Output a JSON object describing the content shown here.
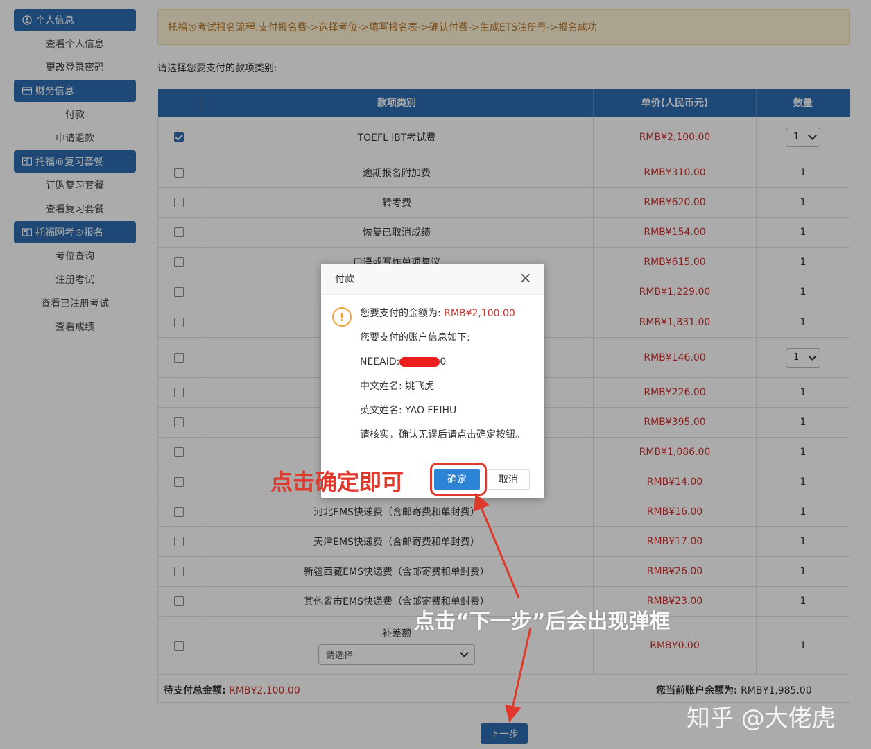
{
  "sidebar": {
    "sections": [
      {
        "title": "个人信息",
        "icon": "user-circle-icon",
        "items": [
          "查看个人信息",
          "更改登录密码"
        ]
      },
      {
        "title": "财务信息",
        "icon": "credit-card-icon",
        "items": [
          "付款",
          "申请退款"
        ]
      },
      {
        "title": "托福®复习套餐",
        "icon": "book-icon",
        "items": [
          "订购复习套餐",
          "查看复习套餐"
        ]
      },
      {
        "title": "托福网考®报名",
        "icon": "book-icon",
        "items": [
          "考位查询",
          "注册考试",
          "查看已注册考试",
          "查看成绩"
        ]
      }
    ]
  },
  "notice": "托福®考试报名流程:支付报名费->选择考位->填写报名表->确认付费->生成ETS注册号->报名成功",
  "prompt": "请选择您要支付的款项类别:",
  "table": {
    "headers": [
      "",
      "款项类别",
      "单价(人民币元)",
      "数量"
    ],
    "rows": [
      {
        "checked": true,
        "name": "TOEFL iBT考试费",
        "price": "RMB¥2,100.00",
        "qty": "1",
        "qty_select": true
      },
      {
        "checked": false,
        "name": "逾期报名附加费",
        "price": "RMB¥310.00",
        "qty": "1",
        "qty_select": false
      },
      {
        "checked": false,
        "name": "转考费",
        "price": "RMB¥620.00",
        "qty": "1",
        "qty_select": false
      },
      {
        "checked": false,
        "name": "恢复已取消成绩",
        "price": "RMB¥154.00",
        "qty": "1",
        "qty_select": false
      },
      {
        "checked": false,
        "name": "口语或写作单项复议",
        "price": "RMB¥615.00",
        "qty": "1",
        "qty_select": false
      },
      {
        "checked": false,
        "name": "",
        "price": "RMB¥1,229.00",
        "qty": "1",
        "qty_select": false
      },
      {
        "checked": false,
        "name": "",
        "price": "RMB¥1,831.00",
        "qty": "1",
        "qty_select": false
      },
      {
        "checked": false,
        "name": "",
        "price": "RMB¥146.00",
        "qty": "1",
        "qty_select": true
      },
      {
        "checked": false,
        "name": "",
        "price": "RMB¥226.00",
        "qty": "1",
        "qty_select": false
      },
      {
        "checked": false,
        "name": "",
        "price": "RMB¥395.00",
        "qty": "1",
        "qty_select": false
      },
      {
        "checked": false,
        "name": "",
        "price": "RMB¥1,086.00",
        "qty": "1",
        "qty_select": false
      },
      {
        "checked": false,
        "name": "",
        "price": "RMB¥14.00",
        "qty": "1",
        "qty_select": false
      },
      {
        "checked": false,
        "name": "河北EMS快递费（含邮寄费和单封费）",
        "price": "RMB¥16.00",
        "qty": "1",
        "qty_select": false
      },
      {
        "checked": false,
        "name": "天津EMS快递费（含邮寄费和单封费）",
        "price": "RMB¥17.00",
        "qty": "1",
        "qty_select": false
      },
      {
        "checked": false,
        "name": "新疆西藏EMS快递费（含邮寄费和单封费）",
        "price": "RMB¥26.00",
        "qty": "1",
        "qty_select": false
      },
      {
        "checked": false,
        "name": "其他省市EMS快递费（含邮寄费和单封费）",
        "price": "RMB¥23.00",
        "qty": "1",
        "qty_select": false
      }
    ],
    "buchae": {
      "label": "补差额",
      "select_value": "请选择",
      "price": "RMB¥0.00",
      "qty": "1"
    }
  },
  "footer": {
    "total_label": "待支付总金额:",
    "total_value": "RMB¥2,100.00",
    "balance_label": "您当前账户余额为:",
    "balance_value": "RMB¥1,985.00",
    "next_button": "下一步"
  },
  "modal": {
    "title": "付款",
    "amount_label": "您要支付的金额为:",
    "amount_value": "RMB¥2,100.00",
    "account_intro": "您要支付的账户信息如下:",
    "neeaid_label": "NEEAID:",
    "neeaid_tail": "0",
    "cn_name": "中文姓名: 姚飞虎",
    "en_name": "英文姓名: YAO FEIHU",
    "confirm_note": "请核实，确认无误后请点击确定按钮。",
    "ok_button": "确定",
    "cancel_button": "取消"
  },
  "annotations": {
    "click_ok": "点击确定即可",
    "after_next": "点击“下一步”后会出现弹框",
    "watermark": "知乎 @大佬虎",
    "color": "#e0392b"
  },
  "colors": {
    "primary": "#2d6cb0",
    "price_red": "#d0312d",
    "notice_bg": "#fcf4d6",
    "notice_text": "#b8752b"
  }
}
